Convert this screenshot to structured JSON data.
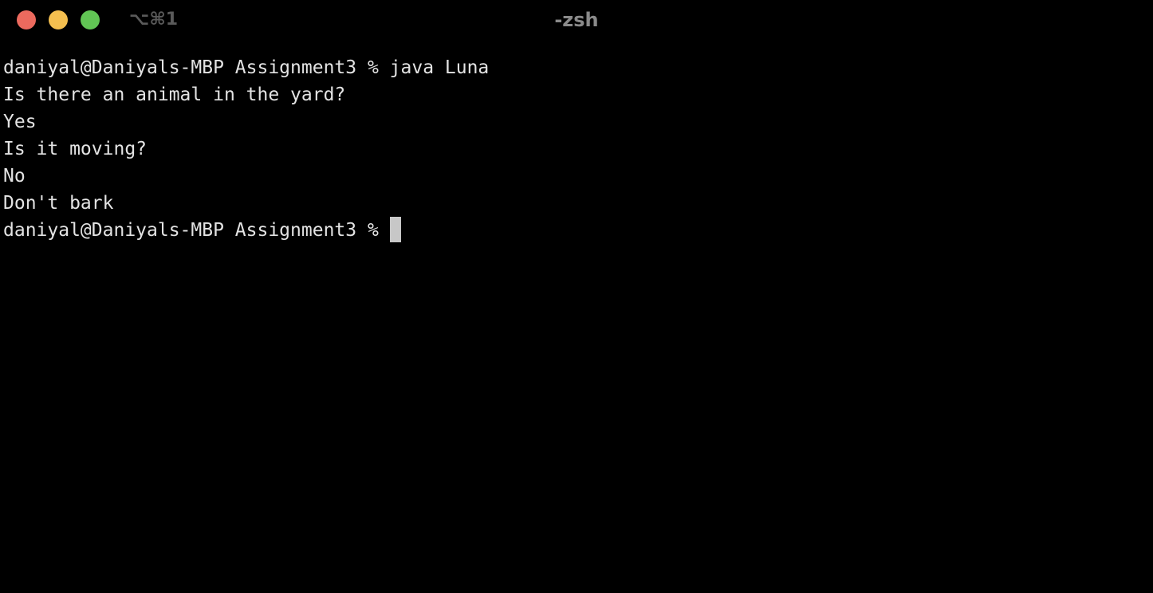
{
  "window": {
    "title": "-zsh",
    "shortcut": "⌥⌘1",
    "buttons": [
      {
        "name": "close",
        "color": "#ec6a5e"
      },
      {
        "name": "minimize",
        "color": "#f4bf4f"
      },
      {
        "name": "zoom",
        "color": "#61c554"
      }
    ]
  },
  "terminal": {
    "background": "#000000",
    "foreground": "#e3e3e3",
    "lines": [
      "daniyal@Daniyals-MBP Assignment3 % java Luna",
      "Is there an animal in the yard?",
      "Yes",
      "Is it moving?",
      "No",
      "Don't bark"
    ],
    "prompt": "daniyal@Daniyals-MBP Assignment3 % ",
    "cursor_color": "#c7c7c7"
  }
}
